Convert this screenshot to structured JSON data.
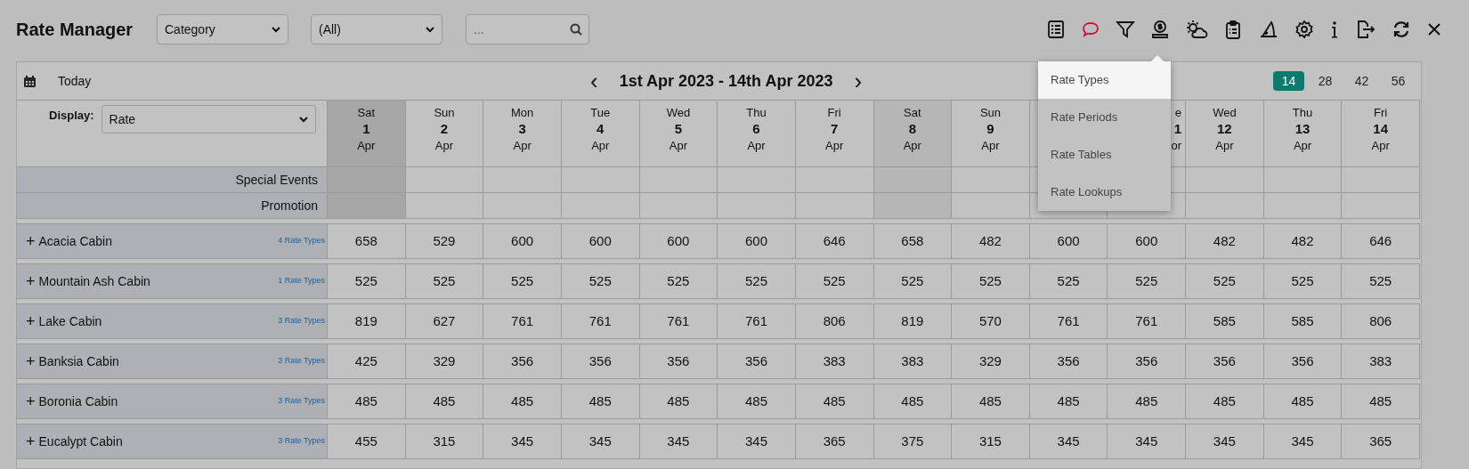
{
  "title": "Rate Manager",
  "filters": [
    {
      "value": "Category"
    },
    {
      "value": "(All)"
    }
  ],
  "search": {
    "placeholder": "..."
  },
  "calendar": {
    "today_label": "Today",
    "range": "1st Apr 2023 - 14th Apr 2023",
    "prev": "‹",
    "next": "›"
  },
  "page_sizes": [
    {
      "label": "14",
      "selected": true
    },
    {
      "label": "28",
      "selected": false
    },
    {
      "label": "42",
      "selected": false
    },
    {
      "label": "56",
      "selected": false
    }
  ],
  "display": {
    "label": "Display:",
    "value": "Rate"
  },
  "days": [
    {
      "weekday": "Sat",
      "day": "1",
      "month": "Apr",
      "weekend": true,
      "today": true
    },
    {
      "weekday": "Sun",
      "day": "2",
      "month": "Apr",
      "weekend": false,
      "today": false
    },
    {
      "weekday": "Mon",
      "day": "3",
      "month": "Apr",
      "weekend": false,
      "today": false
    },
    {
      "weekday": "Tue",
      "day": "4",
      "month": "Apr",
      "weekend": false,
      "today": false
    },
    {
      "weekday": "Wed",
      "day": "5",
      "month": "Apr",
      "weekend": false,
      "today": false
    },
    {
      "weekday": "Thu",
      "day": "6",
      "month": "Apr",
      "weekend": false,
      "today": false
    },
    {
      "weekday": "Fri",
      "day": "7",
      "month": "Apr",
      "weekend": false,
      "today": false
    },
    {
      "weekday": "Sat",
      "day": "8",
      "month": "Apr",
      "weekend": true,
      "today": false
    },
    {
      "weekday": "Sun",
      "day": "9",
      "month": "Apr",
      "weekend": false,
      "today": false
    },
    {
      "weekend": false,
      "today": false
    },
    {
      "kind": "covered",
      "weekday": "e",
      "day": "1",
      "month": "or",
      "weekend": false,
      "today": false
    },
    {
      "weekday": "Wed",
      "day": "12",
      "month": "Apr",
      "weekend": false,
      "today": false
    },
    {
      "weekday": "Thu",
      "day": "13",
      "month": "Apr",
      "weekend": false,
      "today": false
    },
    {
      "weekday": "Fri",
      "day": "14",
      "month": "Apr",
      "weekend": false,
      "today": false
    }
  ],
  "info_rows": [
    {
      "label": "Special Events"
    },
    {
      "label": "Promotion"
    }
  ],
  "rooms": [
    {
      "expander": "+",
      "name": "Acacia Cabin",
      "rate_types": "4 Rate Types",
      "rates": [
        "658",
        "529",
        "600",
        "600",
        "600",
        "600",
        "646",
        "658",
        "482",
        "600",
        "600",
        "482",
        "482",
        "646"
      ]
    },
    {
      "expander": "+",
      "name": "Mountain Ash Cabin",
      "rate_types": "1 Rate Types",
      "rates": [
        "525",
        "525",
        "525",
        "525",
        "525",
        "525",
        "525",
        "525",
        "525",
        "525",
        "525",
        "525",
        "525",
        "525"
      ]
    },
    {
      "expander": "+",
      "name": "Lake Cabin",
      "rate_types": "3 Rate Types",
      "rates": [
        "819",
        "627",
        "761",
        "761",
        "761",
        "761",
        "806",
        "819",
        "570",
        "761",
        "761",
        "585",
        "585",
        "806"
      ]
    },
    {
      "expander": "+",
      "name": "Banksia Cabin",
      "rate_types": "3 Rate Types",
      "rates": [
        "425",
        "329",
        "356",
        "356",
        "356",
        "356",
        "383",
        "383",
        "329",
        "356",
        "356",
        "356",
        "356",
        "383"
      ]
    },
    {
      "expander": "+",
      "name": "Boronia Cabin",
      "rate_types": "3 Rate Types",
      "rates": [
        "485",
        "485",
        "485",
        "485",
        "485",
        "485",
        "485",
        "485",
        "485",
        "485",
        "485",
        "485",
        "485",
        "485"
      ]
    },
    {
      "expander": "+",
      "name": "Eucalypt Cabin",
      "rate_types": "3 Rate Types",
      "rates": [
        "455",
        "315",
        "345",
        "345",
        "345",
        "345",
        "365",
        "375",
        "315",
        "345",
        "345",
        "345",
        "345",
        "365"
      ]
    }
  ],
  "menu": {
    "items": [
      {
        "label": "Rate Types",
        "selected": true
      },
      {
        "label": "Rate Periods",
        "selected": false
      },
      {
        "label": "Rate Tables",
        "selected": false
      },
      {
        "label": "Rate Lookups",
        "selected": false
      }
    ]
  }
}
